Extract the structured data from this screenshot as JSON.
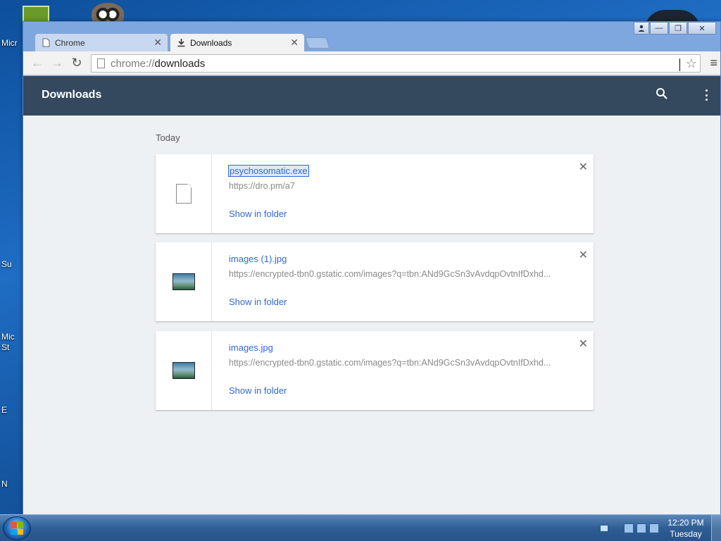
{
  "desktop": {
    "labels": [
      "Micr",
      "Su",
      "Mic",
      "St",
      "E",
      "N"
    ]
  },
  "tabs": [
    {
      "label": "Chrome"
    },
    {
      "label": "Downloads"
    }
  ],
  "window": {
    "user_icon": "person-icon",
    "minimize_glyph": "—",
    "maximize_glyph": "❐",
    "close_glyph": "✕"
  },
  "toolbar": {
    "back_glyph": "←",
    "forward_glyph": "→",
    "reload_glyph": "↻",
    "url_scheme": "chrome://",
    "url_host": "downloads",
    "star_glyph": "☆",
    "menu_glyph": "≡"
  },
  "header": {
    "title": "Downloads"
  },
  "downloads": {
    "date_label": "Today",
    "items": [
      {
        "name": "psychosomatic.exe",
        "url": "https://dro.pm/a7",
        "action": "Show in folder",
        "type": "generic",
        "selected": true
      },
      {
        "name": "images (1).jpg",
        "url": "https://encrypted-tbn0.gstatic.com/images?q=tbn:ANd9GcSn3vAvdqpOvtnIfDxhd...",
        "action": "Show in folder",
        "type": "image",
        "selected": false
      },
      {
        "name": "images.jpg",
        "url": "https://encrypted-tbn0.gstatic.com/images?q=tbn:ANd9GcSn3vAvdqpOvtnIfDxhd...",
        "action": "Show in folder",
        "type": "image",
        "selected": false
      }
    ],
    "remove_glyph": "✕"
  },
  "taskbar": {
    "clock_time": "12:20 PM",
    "clock_day": "Tuesday"
  }
}
